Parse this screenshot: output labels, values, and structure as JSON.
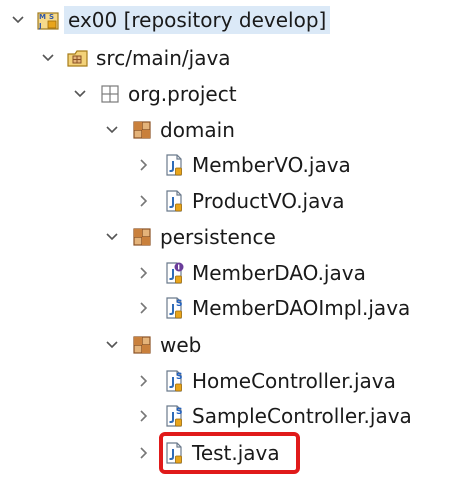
{
  "tree": {
    "root": {
      "label": "ex00 [repository develop]",
      "icon": "maven-project-icon"
    },
    "source_folder": {
      "label": "src/main/java",
      "icon": "source-folder-icon"
    },
    "root_package": {
      "label": "org.project",
      "icon": "package-icon"
    },
    "packages": [
      {
        "label": "domain",
        "files": [
          {
            "label": "MemberVO.java",
            "icon": "java-file-icon"
          },
          {
            "label": "ProductVO.java",
            "icon": "java-file-icon"
          }
        ]
      },
      {
        "label": "persistence",
        "files": [
          {
            "label": "MemberDAO.java",
            "icon": "java-interface-file-icon"
          },
          {
            "label": "MemberDAOImpl.java",
            "icon": "java-spring-bean-file-icon"
          }
        ]
      },
      {
        "label": "web",
        "files": [
          {
            "label": "HomeController.java",
            "icon": "java-spring-bean-file-icon"
          },
          {
            "label": "SampleController.java",
            "icon": "java-spring-bean-file-icon"
          },
          {
            "label": "Test.java",
            "icon": "java-file-icon",
            "highlighted": true
          }
        ]
      }
    ]
  },
  "colors": {
    "highlight_border": "#e01a1a",
    "selection_background": "#dbe9f7",
    "package_icon": "#a0662a",
    "spring_badge": "#1f5fbf",
    "interface_badge": "#6a3d9a"
  }
}
